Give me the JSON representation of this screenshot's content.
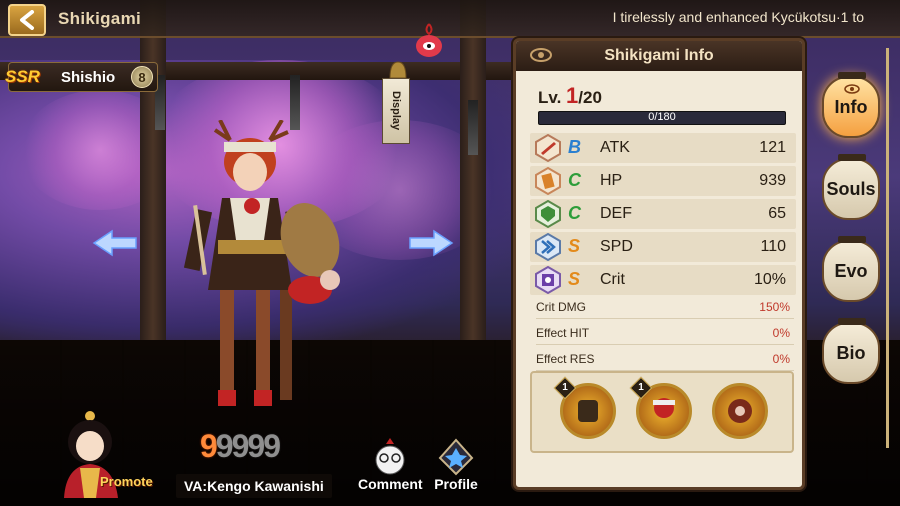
{
  "header": {
    "title": "Shikigami",
    "marquee": "I tirelessly and enhanced Kycükotsu·1 to"
  },
  "character": {
    "rarity": "SSR",
    "name": "Shishio",
    "star": "8"
  },
  "display_sign": "Display",
  "panel": {
    "title": "Shikigami Info",
    "level_prefix": "Lv.",
    "level_current": "1",
    "level_max": "/20",
    "exp_text": "0/180",
    "exp_fraction": 0.0,
    "stats": [
      {
        "grade": "B",
        "grade_color": "#2a7fd0",
        "label": "ATK",
        "value": "121"
      },
      {
        "grade": "C",
        "grade_color": "#2e9d3a",
        "label": "HP",
        "value": "939"
      },
      {
        "grade": "C",
        "grade_color": "#2e9d3a",
        "label": "DEF",
        "value": "65"
      },
      {
        "grade": "S",
        "grade_color": "#e38a1a",
        "label": "SPD",
        "value": "110"
      },
      {
        "grade": "S",
        "grade_color": "#e38a1a",
        "label": "Crit",
        "value": "10%"
      }
    ],
    "minor_stats": [
      {
        "label": "Crit DMG",
        "value": "150%"
      },
      {
        "label": "Effect HIT",
        "value": "0%"
      },
      {
        "label": "Effect RES",
        "value": "0%"
      }
    ],
    "skills": [
      {
        "level": "1"
      },
      {
        "level": "1"
      },
      {
        "level": ""
      }
    ]
  },
  "tabs": [
    {
      "label": "Info",
      "active": true
    },
    {
      "label": "Souls",
      "active": false
    },
    {
      "label": "Evo",
      "active": false
    },
    {
      "label": "Bio",
      "active": false
    }
  ],
  "bottom": {
    "promote_label": "Promote",
    "counter_on": "9",
    "counter_off": "9999",
    "va_label": "VA:Kengo Kawanishi",
    "comment_label": "Comment",
    "profile_label": "Profile"
  },
  "colors": {
    "accent": "#f5a040",
    "panel_bg": "#f2ead9",
    "level_current": "#c22424",
    "minor_value": "#c0392b"
  }
}
